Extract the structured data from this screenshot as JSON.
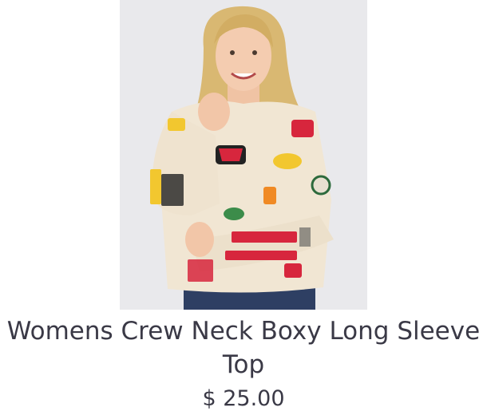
{
  "product": {
    "title": "Womens Crew Neck Boxy  Long Sleeve Top",
    "price": "$ 25.00"
  },
  "image": {
    "subject": "model wearing cream long sleeve top with embroidered racing patches",
    "background_color": "#e9e9ec",
    "garment_color": "#f1e6d3"
  },
  "colors": {
    "text": "#3a3946",
    "patch_red": "#d7263d",
    "patch_yellow": "#f2c72f"
  }
}
